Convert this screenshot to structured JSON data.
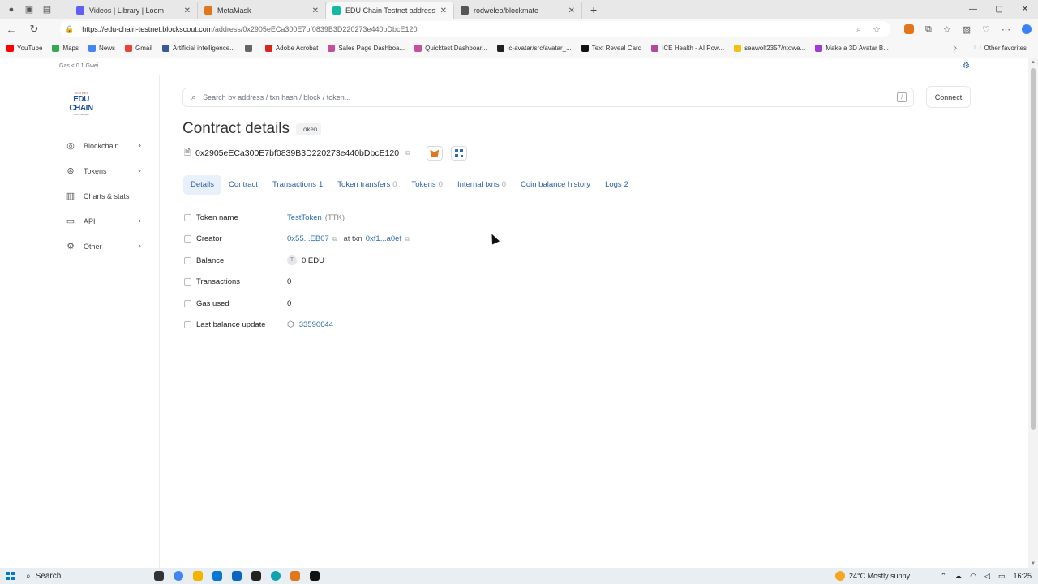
{
  "browser": {
    "tabs": [
      {
        "title": "Videos | Library | Loom",
        "fav": "#625df5"
      },
      {
        "title": "MetaMask",
        "fav": "#e2761b"
      },
      {
        "title": "EDU Chain Testnet address details",
        "fav": "#14b8a6",
        "active": true
      },
      {
        "title": "rodweleo/blockmate",
        "fav": "#555555"
      }
    ],
    "url_host": "https://edu-chain-testnet.blockscout.com",
    "url_path": "/address/0x2905eECa300E7bf0839B3D220273e440bDbcE120",
    "bookmarks": [
      {
        "label": "YouTube",
        "color": "#ff0000"
      },
      {
        "label": "Maps",
        "color": "#34a853"
      },
      {
        "label": "News",
        "color": "#4285f4"
      },
      {
        "label": "Gmail",
        "color": "#ea4335"
      },
      {
        "label": "Artificial intelligence...",
        "color": "#3b5998"
      },
      {
        "label": "",
        "color": "#666666"
      },
      {
        "label": "Adobe Acrobat",
        "color": "#d7261e"
      },
      {
        "label": "Sales Page Dashboa...",
        "color": "#c44f9e"
      },
      {
        "label": "Quicktest Dashboar...",
        "color": "#c44f9e"
      },
      {
        "label": "ic-avatar/src/avatar_...",
        "color": "#222222"
      },
      {
        "label": "Text Reveal Card",
        "color": "#111111"
      },
      {
        "label": "ICE Health - AI Pow...",
        "color": "#b04aa0"
      },
      {
        "label": "seawolf2357/ntowe...",
        "color": "#f4c20d"
      },
      {
        "label": "Make a 3D Avatar B...",
        "color": "#9b3dd6"
      }
    ],
    "other_favorites": "Other favorites"
  },
  "gas": {
    "label": "Gas",
    "value": "< 0.1 Gwei"
  },
  "logo": {
    "top": "TESTNET",
    "main": "EDU CHAIN",
    "sub": "Open Campus"
  },
  "sidebar": {
    "items": [
      {
        "label": "Blockchain",
        "icon": "globe-icon",
        "glyph": "◎",
        "chevron": true
      },
      {
        "label": "Tokens",
        "icon": "tokens-icon",
        "glyph": "⊛",
        "chevron": true
      },
      {
        "label": "Charts & stats",
        "icon": "chart-icon",
        "glyph": "▥",
        "chevron": false
      },
      {
        "label": "API",
        "icon": "api-icon",
        "glyph": "▭",
        "chevron": true
      },
      {
        "label": "Other",
        "icon": "gear-icon",
        "glyph": "⚙",
        "chevron": true
      }
    ]
  },
  "search": {
    "placeholder": "Search by address / txn hash / block / token..."
  },
  "connect_label": "Connect",
  "page_title": "Contract details",
  "title_badge": "Token",
  "address": "0x2905eECa300E7bf0839B3D220273e440bDbcE120",
  "tabs": [
    {
      "label": "Details",
      "count": ""
    },
    {
      "label": "Contract",
      "count": ""
    },
    {
      "label": "Transactions",
      "count": "1"
    },
    {
      "label": "Token transfers",
      "count": "0"
    },
    {
      "label": "Tokens",
      "count": "0"
    },
    {
      "label": "Internal txns",
      "count": "0"
    },
    {
      "label": "Coin balance history",
      "count": ""
    },
    {
      "label": "Logs",
      "count": "2"
    }
  ],
  "details": {
    "token_name_label": "Token name",
    "token_name": "TestToken",
    "token_symbol": "(TTK)",
    "creator_label": "Creator",
    "creator": "0x55...EB07",
    "at_txn": "at txn",
    "creator_txn": "0xf1...a0ef",
    "balance_label": "Balance",
    "balance_coin": "T",
    "balance": "0 EDU",
    "transactions_label": "Transactions",
    "transactions": "0",
    "gas_used_label": "Gas used",
    "gas_used": "0",
    "last_update_label": "Last balance update",
    "last_update": "33590644"
  },
  "taskbar": {
    "search": "Search",
    "weather": "24°C  Mostly sunny",
    "time": "16:25"
  }
}
